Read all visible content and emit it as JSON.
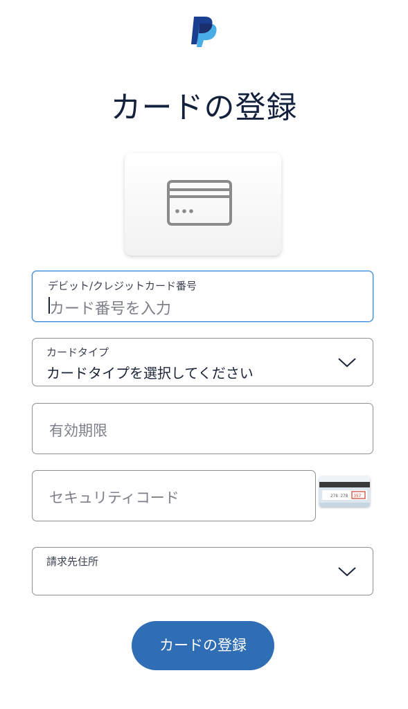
{
  "brand": {
    "logo_icon": "paypal-logo-icon",
    "color_dark": "#1b3f8f",
    "color_light": "#3fa9e6"
  },
  "page": {
    "title": "カードの登録"
  },
  "card_illustration": {
    "icon": "credit-card-icon"
  },
  "form": {
    "card_number": {
      "label": "デビット/クレジットカード番号",
      "placeholder": "カード番号を入力",
      "value": ""
    },
    "card_type": {
      "label": "カードタイプ",
      "value": "カードタイプを選択してください",
      "icon": "chevron-down-icon"
    },
    "expiry": {
      "placeholder": "有効期限"
    },
    "security_code": {
      "placeholder": "セキュリティコード",
      "help_image": "cvv-card-back-image",
      "card_digits": "278 278",
      "cvv_digits": "357"
    },
    "billing_address": {
      "label": "請求先住所",
      "value": "",
      "icon": "chevron-down-icon"
    }
  },
  "actions": {
    "submit_label": "カードの登録"
  },
  "colors": {
    "accent": "#2f6db5",
    "focus_border": "#2f7fd4",
    "border": "#8d8f94",
    "title_text": "#13213c"
  }
}
